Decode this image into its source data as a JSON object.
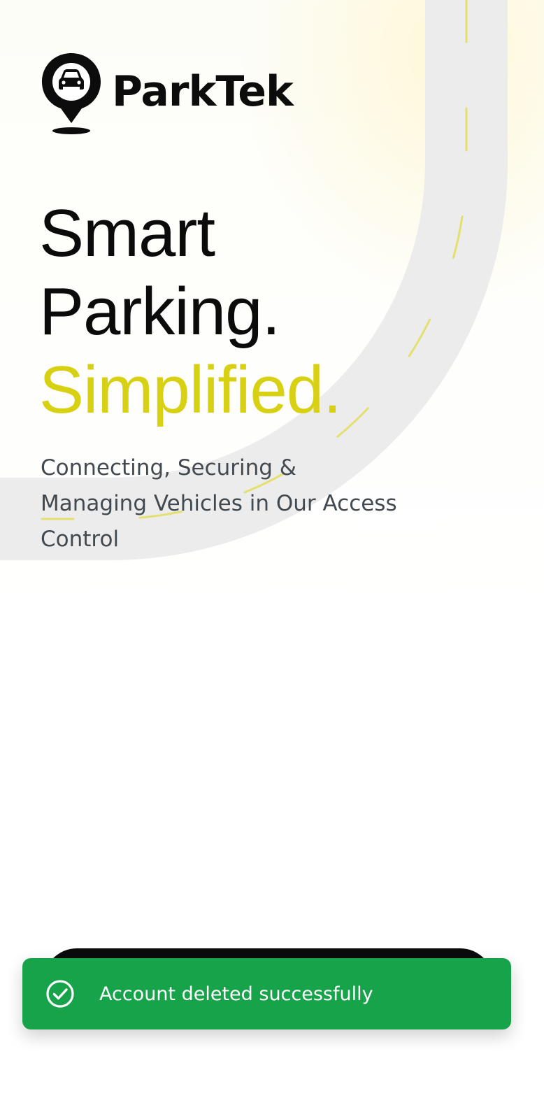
{
  "brand": {
    "name": "ParkTek",
    "logo_icon": "location-pin-car-icon"
  },
  "hero": {
    "line1": "Smart",
    "line2": "Parking.",
    "line3": "Simplified.",
    "subtitle": "Connecting, Securing & Managing Vehicles in Our Access Control"
  },
  "toast": {
    "icon": "check-circle-icon",
    "message": "Account deleted successfully"
  },
  "colors": {
    "accent": "#d8d012",
    "text_dark": "#0b0b0b",
    "text_muted": "#424a50",
    "toast_bg": "#17a34a",
    "road": "#ececec"
  }
}
